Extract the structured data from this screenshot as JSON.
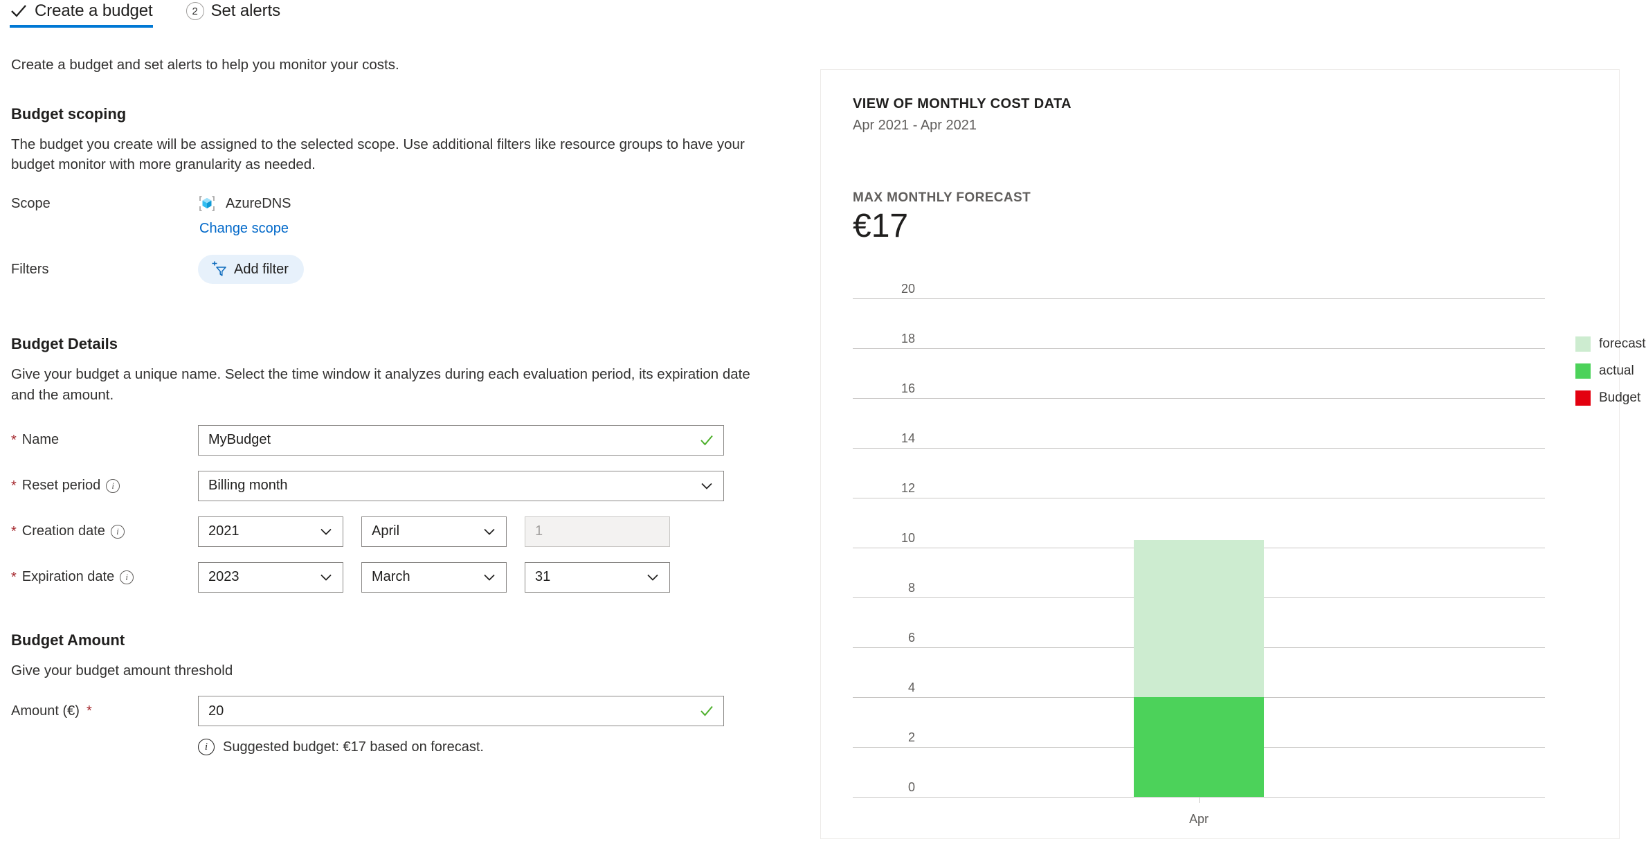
{
  "wizard": {
    "steps": [
      {
        "label": "Create a budget",
        "state": "completed",
        "icon": "check-icon",
        "active": true
      },
      {
        "label": "Set alerts",
        "state": "pending",
        "number": "2",
        "active": false
      }
    ],
    "accent_color": "#0078d4"
  },
  "intro": "Create a budget and set alerts to help you monitor your costs.",
  "budget_scoping": {
    "title": "Budget scoping",
    "description": "The budget you create will be assigned to the selected scope. Use additional filters like resource groups to have your budget monitor with more granularity as needed.",
    "scope_label": "Scope",
    "scope_value": "AzureDNS",
    "scope_icon": "azure-resource-cube-icon",
    "change_scope_link": "Change scope",
    "filters_label": "Filters",
    "add_filter_label": "Add filter",
    "add_filter_icon": "add-filter-funnel-icon"
  },
  "budget_details": {
    "title": "Budget Details",
    "description": "Give your budget a unique name. Select the time window it analyzes during each evaluation period, its expiration date and the amount.",
    "name_label": "Name",
    "name_value": "MyBudget",
    "name_required": true,
    "name_valid": true,
    "reset_period_label": "Reset period",
    "reset_period_value": "Billing month",
    "creation_date_label": "Creation date",
    "creation_year": "2021",
    "creation_month": "April",
    "creation_day": "1",
    "creation_day_disabled": true,
    "expiration_date_label": "Expiration date",
    "expiration_year": "2023",
    "expiration_month": "March",
    "expiration_day": "31"
  },
  "budget_amount": {
    "title": "Budget Amount",
    "description": "Give your budget amount threshold",
    "amount_label": "Amount (€)",
    "amount_value": "20",
    "amount_required": true,
    "amount_valid": true,
    "suggestion": "Suggested budget: €17 based on forecast."
  },
  "chart_panel": {
    "title": "VIEW OF MONTHLY COST DATA",
    "subtitle": "Apr 2021 - Apr 2021",
    "forecast_caption": "MAX MONTHLY FORECAST",
    "forecast_amount": "€17"
  },
  "chart_data": {
    "type": "bar",
    "title": "VIEW OF MONTHLY COST DATA",
    "subtitle": "Apr 2021 - Apr 2021",
    "stacked": true,
    "categories": [
      "Apr"
    ],
    "series": [
      {
        "name": "actual",
        "values": [
          4
        ],
        "color": "#4cd25a"
      },
      {
        "name": "forecast",
        "values": [
          6.3
        ],
        "color": "#cdecd0"
      }
    ],
    "legend": [
      {
        "label": "forecast",
        "color": "#cdecd0"
      },
      {
        "label": "actual",
        "color": "#4cd25a"
      },
      {
        "label": "Budget",
        "color": "#e3000f"
      }
    ],
    "legend_position": "right",
    "xlabel": "",
    "ylabel": "",
    "ylim": [
      0,
      20
    ],
    "yticks": [
      20,
      18,
      16,
      14,
      12,
      10,
      8,
      6,
      4,
      2,
      0
    ],
    "grid": true,
    "xtick_labels": [
      "Apr"
    ]
  }
}
